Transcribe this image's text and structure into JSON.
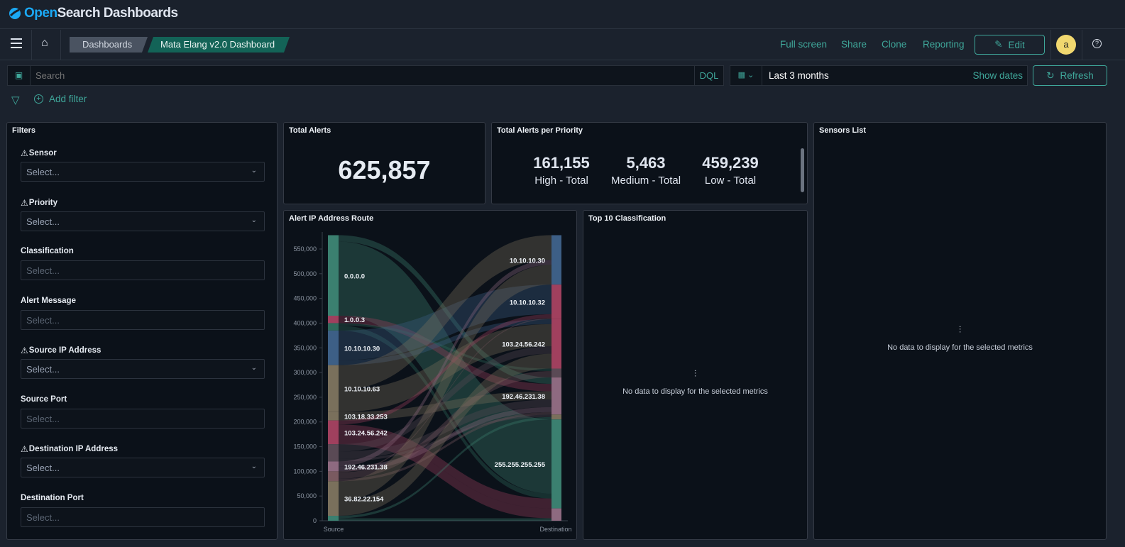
{
  "app": {
    "logo_open": "Open",
    "logo_rest": "Search Dashboards"
  },
  "nav": {
    "breadcrumbs": [
      "Dashboards",
      "Mata Elang v2.0 Dashboard"
    ],
    "links": [
      "Full screen",
      "Share",
      "Clone",
      "Reporting"
    ],
    "edit": "Edit",
    "avatar": "a",
    "help": "?"
  },
  "query": {
    "placeholder": "Search",
    "language": "DQL",
    "time": "Last 3 months",
    "show_dates": "Show dates",
    "refresh": "Refresh",
    "add_filter": "Add filter"
  },
  "filters": {
    "title": "Filters",
    "fields": [
      {
        "label": "Sensor",
        "placeholder": "Select...",
        "warning": true,
        "dropdown": true
      },
      {
        "label": "Priority",
        "placeholder": "Select...",
        "warning": true,
        "dropdown": true
      },
      {
        "label": "Classification",
        "placeholder": "Select...",
        "warning": false,
        "dropdown": false
      },
      {
        "label": "Alert Message",
        "placeholder": "Select...",
        "warning": false,
        "dropdown": false
      },
      {
        "label": "Source IP Address",
        "placeholder": "Select...",
        "warning": true,
        "dropdown": true
      },
      {
        "label": "Source Port",
        "placeholder": "Select...",
        "warning": false,
        "dropdown": false
      },
      {
        "label": "Destination IP Address",
        "placeholder": "Select...",
        "warning": true,
        "dropdown": true
      },
      {
        "label": "Destination Port",
        "placeholder": "Select...",
        "warning": false,
        "dropdown": false
      }
    ]
  },
  "total_alerts": {
    "title": "Total Alerts",
    "value": "625,857"
  },
  "priority": {
    "title": "Total Alerts per Priority",
    "items": [
      {
        "value": "161,155",
        "label": "High - Total"
      },
      {
        "value": "5,463",
        "label": "Medium - Total"
      },
      {
        "value": "459,239",
        "label": "Low - Total"
      }
    ]
  },
  "sensors": {
    "title": "Sensors List",
    "empty": "No data to display for the selected metrics"
  },
  "top10": {
    "title": "Top 10 Classification",
    "empty": "No data to display for the selected metrics"
  },
  "colors": {
    "accent": "#3fa79a",
    "teal": "#3b8070",
    "pink": "#a0405e",
    "blue": "#3d5f86",
    "tan": "#7a705c",
    "mauve": "#8e6a80",
    "avatar": "#f1d86f"
  },
  "chart_data": {
    "type": "sankey",
    "title": "Alert IP Address Route",
    "xlabels": [
      "Source",
      "Destination"
    ],
    "yticks": [
      0,
      50000,
      100000,
      150000,
      200000,
      250000,
      300000,
      350000,
      400000,
      450000,
      500000,
      550000
    ],
    "sources": [
      {
        "name": "0.0.0.0",
        "color": "#3b8070"
      },
      {
        "name": "1.0.0.3",
        "color": "#a0405e"
      },
      {
        "name": "",
        "color": "#2f6b5c"
      },
      {
        "name": "10.10.10.30",
        "color": "#3d5f86"
      },
      {
        "name": "10.10.10.63",
        "color": "#7a705c"
      },
      {
        "name": "103.18.33.253",
        "color": "#7a705c"
      },
      {
        "name": "103.24.56.242",
        "color": "#a0405e"
      },
      {
        "name": "",
        "color": "#5a4a55"
      },
      {
        "name": "192.46.231.38",
        "color": "#8e6a80"
      },
      {
        "name": "",
        "color": "#7a5a60"
      },
      {
        "name": "36.82.22.154",
        "color": "#7a705c"
      },
      {
        "name": "",
        "color": "#3b8070"
      }
    ],
    "targets": [
      {
        "name": "10.10.10.30",
        "color": "#3d5f86"
      },
      {
        "name": "10.10.10.32",
        "color": "#a0405e"
      },
      {
        "name": "103.24.56.242",
        "color": "#a0405e"
      },
      {
        "name": "",
        "color": "#5a4a55"
      },
      {
        "name": "192.46.231.38",
        "color": "#8e6a80"
      },
      {
        "name": "",
        "color": "#7a705c"
      },
      {
        "name": "255.255.255.255",
        "color": "#3b8070"
      },
      {
        "name": "",
        "color": "#8e6a80"
      }
    ],
    "links": [
      [
        0,
        6,
        150000
      ],
      [
        0,
        4,
        13000
      ],
      [
        1,
        4,
        15000
      ],
      [
        2,
        6,
        10000
      ],
      [
        2,
        3,
        5000
      ],
      [
        3,
        1,
        60000
      ],
      [
        3,
        2,
        10000
      ],
      [
        4,
        0,
        50000
      ],
      [
        4,
        2,
        45000
      ],
      [
        5,
        4,
        17000
      ],
      [
        6,
        7,
        20000
      ],
      [
        6,
        6,
        20000
      ],
      [
        6,
        1,
        8000
      ],
      [
        7,
        2,
        15000
      ],
      [
        7,
        4,
        15000
      ],
      [
        7,
        5,
        5000
      ],
      [
        8,
        0,
        10000
      ],
      [
        8,
        4,
        10000
      ],
      [
        9,
        3,
        13000
      ],
      [
        9,
        4,
        5000
      ],
      [
        9,
        1,
        2000
      ],
      [
        10,
        0,
        40000
      ],
      [
        10,
        2,
        30000
      ],
      [
        11,
        5,
        5000
      ],
      [
        11,
        7,
        5000
      ]
    ]
  }
}
